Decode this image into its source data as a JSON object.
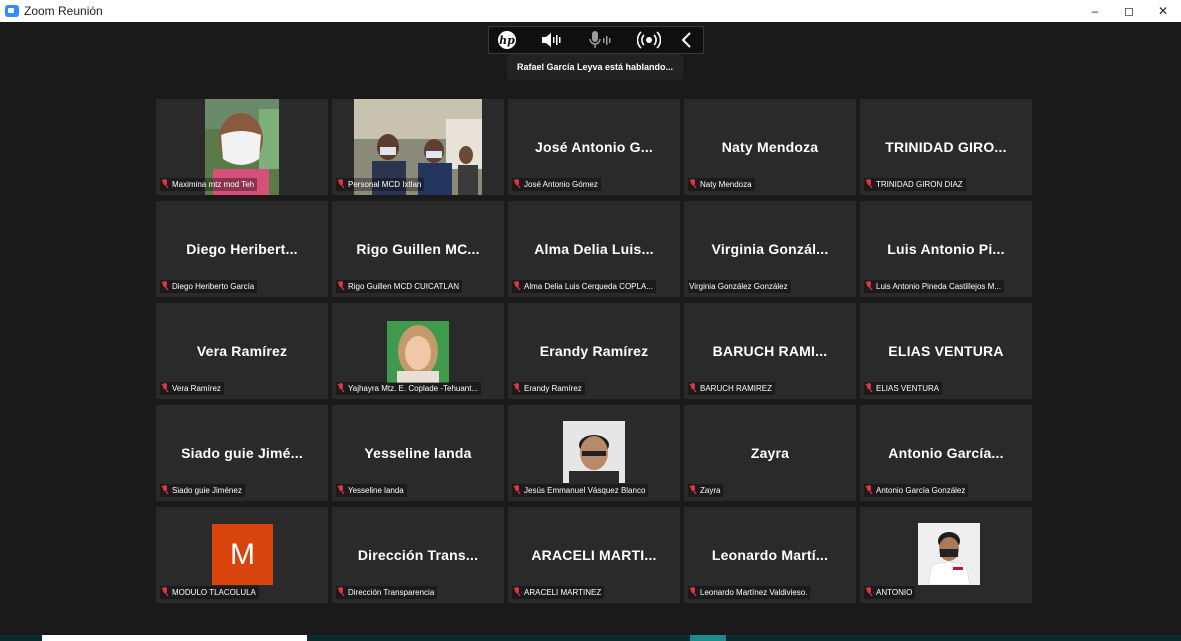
{
  "window": {
    "title": "Zoom Reunión",
    "minimize": "–",
    "maximize": "◻",
    "close": "✕"
  },
  "toolbar": {
    "brand": "hp"
  },
  "speaking_banner": "Rafael García Leyva está hablando...",
  "colors": {
    "tile_bg": "#2a2a2a",
    "stage_bg": "#1a1a1a",
    "mic_muted": "#e0363a",
    "avatar_m": "#d9430e"
  },
  "participants": [
    {
      "display": "",
      "label": "Maximina mtz mod Teh",
      "video": true
    },
    {
      "display": "",
      "label": "Personal MCD Ixtlan",
      "video": true
    },
    {
      "display": "José Antonio G...",
      "label": "José Antonio Gómez",
      "video": false
    },
    {
      "display": "Naty Mendoza",
      "label": "Naty Mendoza",
      "video": false
    },
    {
      "display": "TRINIDAD GIRO...",
      "label": "TRINIDAD GIRON DIAZ",
      "video": false
    },
    {
      "display": "Diego Heribert...",
      "label": "Diego Heriberto García",
      "video": false
    },
    {
      "display": "Rigo Guillen MC...",
      "label": "Rigo Guillen MCD CUICATLAN",
      "video": false
    },
    {
      "display": "Alma Delia Luis...",
      "label": "Alma Delia Luis Cerqueda COPLA...",
      "video": false
    },
    {
      "display": "Virginia Gonzál...",
      "label": "Virginia González González",
      "video": false,
      "unmuted": true
    },
    {
      "display": "Luis Antonio Pi...",
      "label": "Luis Antonio Pineda Castillejos M...",
      "video": false
    },
    {
      "display": "Vera Ramírez",
      "label": "Vera Ramírez",
      "video": false
    },
    {
      "display": "",
      "label": "Yajhayra Mtz. E. Coplade -Tehuant...",
      "video": true
    },
    {
      "display": "Erandy Ramírez",
      "label": "Erandy Ramírez",
      "video": false
    },
    {
      "display": "BARUCH RAMI...",
      "label": "BARUCH RAMIREZ",
      "video": false
    },
    {
      "display": "ELIAS VENTURA",
      "label": "ELIAS VENTURA",
      "video": false
    },
    {
      "display": "Siado guie Jimé...",
      "label": "Siado guie Jiménez",
      "video": false
    },
    {
      "display": "Yesseline landa",
      "label": "Yesseline landa",
      "video": false
    },
    {
      "display": "",
      "label": "Jesús Emmanuel Vásquez Blanco",
      "video": true
    },
    {
      "display": "Zayra",
      "label": "Zayra",
      "video": false
    },
    {
      "display": "Antonio García...",
      "label": "Antonio García González",
      "video": false
    },
    {
      "display": "M",
      "label": "MODULO TLACOLULA",
      "video": false,
      "avatar": true
    },
    {
      "display": "Dirección Trans...",
      "label": "Dirección Transparencia",
      "video": false
    },
    {
      "display": "ARACELI MARTI...",
      "label": "ARACELI MARTINEZ",
      "video": false
    },
    {
      "display": "Leonardo Martí...",
      "label": "Leonardo Martínez Valdivieso.",
      "video": false
    },
    {
      "display": "",
      "label": "ANTONIO",
      "video": true
    }
  ]
}
